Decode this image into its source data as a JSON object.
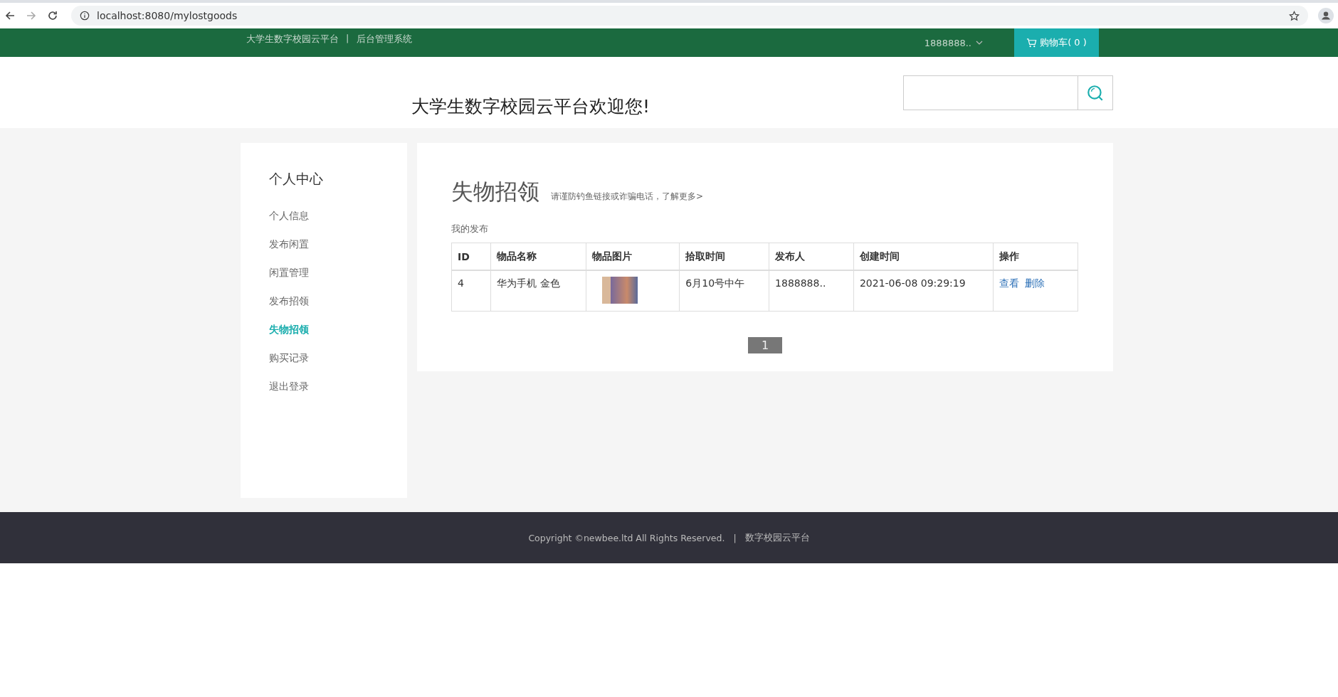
{
  "browser": {
    "url": "localhost:8080/mylostgoods",
    "forward_disabled": true
  },
  "topbar": {
    "brand": "大学生数字校园云平台",
    "separator": "丨",
    "admin_link": "后台管理系统",
    "user": "1888888..",
    "cart": "购物车( 0 )"
  },
  "header": {
    "welcome": "大学生数字校园云平台欢迎您!"
  },
  "sidebar": {
    "title": "个人中心",
    "items": [
      {
        "label": "个人信息",
        "selected": false
      },
      {
        "label": "发布闲置",
        "selected": false
      },
      {
        "label": "闲置管理",
        "selected": false
      },
      {
        "label": "发布招领",
        "selected": false
      },
      {
        "label": "失物招领",
        "selected": true
      },
      {
        "label": "购买记录",
        "selected": false
      },
      {
        "label": "退出登录",
        "selected": false
      }
    ]
  },
  "main": {
    "title": "失物招领",
    "tip": "请谨防钓鱼链接或诈骗电话，了解更多>",
    "section": "我的发布",
    "table": {
      "columns": [
        "ID",
        "物品名称",
        "物品图片",
        "拾取时间",
        "发布人",
        "创建时间",
        "操作"
      ],
      "rows": [
        {
          "id": "4",
          "name": "华为手机 金色",
          "pickup_time": "6月10号中午",
          "publisher": "1888888..",
          "created": "2021-06-08 09:29:19",
          "actions": [
            "查看",
            "删除"
          ]
        }
      ]
    },
    "pages": [
      {
        "label": "1",
        "selected": true
      }
    ]
  },
  "footer": {
    "copyright": "Copyright ©newbee.ltd All Rights Reserved.",
    "separator": "|",
    "site": "数字校园云平台"
  }
}
